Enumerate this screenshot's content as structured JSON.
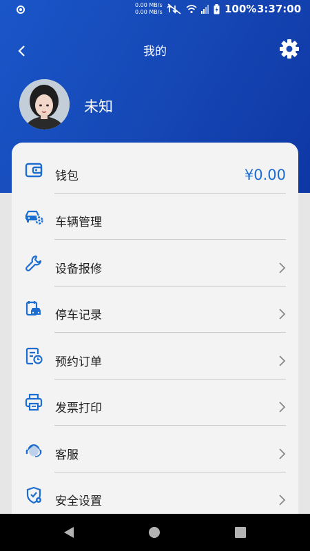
{
  "status_bar": {
    "net_speed_up": "0.00 MB/s",
    "net_speed_down": "0.00 MB/s",
    "battery": "100%",
    "time": "3:37:00"
  },
  "header": {
    "title": "我的",
    "back_icon": "chevron-left-icon",
    "settings_icon": "gear-icon"
  },
  "profile": {
    "name": "未知",
    "avatar_icon": "avatar-illustration"
  },
  "menu": [
    {
      "id": "wallet",
      "label": "钱包",
      "icon": "wallet-icon",
      "value": "¥0.00",
      "chevron": false
    },
    {
      "id": "vehicle",
      "label": "车辆管理",
      "icon": "car-settings-icon",
      "chevron": false
    },
    {
      "id": "repair",
      "label": "设备报修",
      "icon": "wrench-icon",
      "chevron": true
    },
    {
      "id": "parking",
      "label": "停车记录",
      "icon": "parking-record-icon",
      "chevron": true
    },
    {
      "id": "orders",
      "label": "预约订单",
      "icon": "reservation-icon",
      "chevron": true
    },
    {
      "id": "invoice",
      "label": "发票打印",
      "icon": "printer-icon",
      "chevron": true
    },
    {
      "id": "service",
      "label": "客服",
      "icon": "customer-service-icon",
      "chevron": true
    },
    {
      "id": "security",
      "label": "安全设置",
      "icon": "shield-icon",
      "chevron": true
    }
  ],
  "colors": {
    "accent": "#1c6dd0",
    "header_gradient_start": "#1a56c8",
    "header_gradient_end": "#0e37a4"
  }
}
